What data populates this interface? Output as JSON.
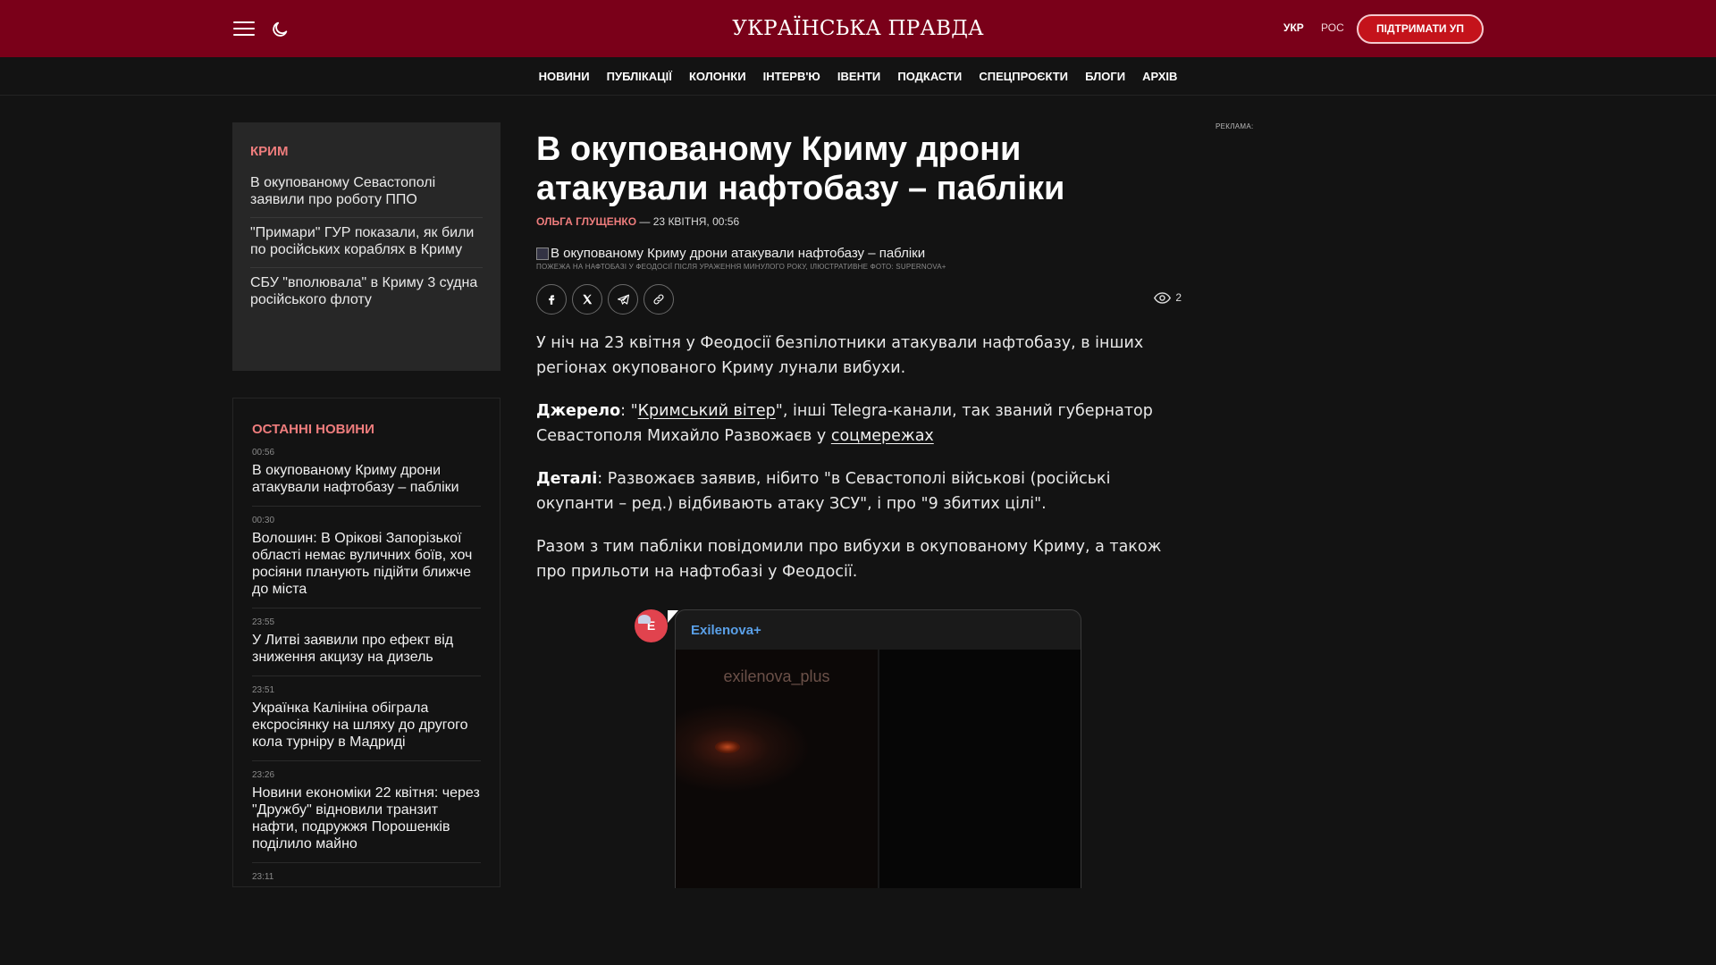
{
  "header": {
    "logo": "УКРАЇНСЬКА ПРАВДА",
    "lang_ukr": "УКР",
    "lang_ros": "РОС",
    "support_label": "ПІДТРИМАТИ УП"
  },
  "nav": [
    "НОВИНИ",
    "ПУБЛІКАЦІЇ",
    "КОЛОНКИ",
    "ІНТЕРВ'Ю",
    "ІВЕНТИ",
    "ПОДКАСТИ",
    "СПЕЦПРОЄКТИ",
    "БЛОГИ",
    "АРХІВ"
  ],
  "crimea": {
    "title": "КРИМ",
    "items": [
      "В окупованому Севастополі заявили про роботу ППО",
      "\"Примари\" ГУР показали, як били по російських кораблях в Криму",
      "СБУ \"вполювала\" в Криму 3 судна російського флоту"
    ]
  },
  "latest": {
    "title": "ОСТАННІ НОВИНИ",
    "items": [
      {
        "time": "00:56",
        "title": "В окупованому Криму дрони атакували нафтобазу – пабліки"
      },
      {
        "time": "00:30",
        "title": "Волошин: В Орікові Запорізької області немає вуличних боїв, хоч росіяни планують підійти ближче до міста"
      },
      {
        "time": "23:55",
        "title": "У Литві заявили про ефект від зниження акцизу на дизель"
      },
      {
        "time": "23:51",
        "title": "Українка Калініна обіграла ексросіянку на шляху до другого кола турніру в Мадриді"
      },
      {
        "time": "23:26",
        "title": "Новини економіки 22 квітня: через \"Дружбу\" відновили транзит нафти, подружжя Порошенків поділило майно"
      },
      {
        "time": "23:11",
        "title": ""
      }
    ]
  },
  "article": {
    "title": "В окупованому Криму дрони атакували нафтобазу – пабліки",
    "author": "ОЛЬГА ГЛУЩЕНКО",
    "date": "— 23 КВІТНЯ, 00:56",
    "image_alt": "В окупованому Криму дрони атакували нафтобазу – пабліки",
    "image_caption": "ПОЖЕЖА НА НАФТОБАЗІ У ФЕОДОСІЇ ПІСЛЯ УРАЖЕННЯ МИНУЛОГО РОКУ, ІЛЮСТРАТИВНЕ ФОТО: SUPERNOVA+",
    "views": "2",
    "lead": "У ніч на 23 квітня у Феодосії безпілотники атакували нафтобазу, в інших регіонах окупованого Криму лунали вибухи.",
    "source_label": "Джерело",
    "source_pre": ": \"",
    "source_link1": "Кримський вітер",
    "source_mid": "\", інші Telegra-канали, так званий губернатор Севастополя Михайло Развожаєв у ",
    "source_link2": "соцмережах",
    "details_label": "Деталі",
    "details_text": ": Развожаєв заявив, нібито \"в Севастополі військові (російські окупанти – ред.) відбивають атаку ЗСУ\", і про \"9 збитих цілі\".",
    "p4": "Разом з тим пабліки повідомили про вибухи в окупованому Криму, а також про прильоти на нафтобазі у Феодосії."
  },
  "embed": {
    "avatar_letter": "E",
    "channel": "Exilenova+",
    "watermark": "exilenova_plus"
  },
  "ads_label": "РЕКЛАМА:",
  "colors": {
    "brand": "#7a0019",
    "accent": "#ef7d7d",
    "support": "#c4131b",
    "link": "#5aa0e8"
  }
}
